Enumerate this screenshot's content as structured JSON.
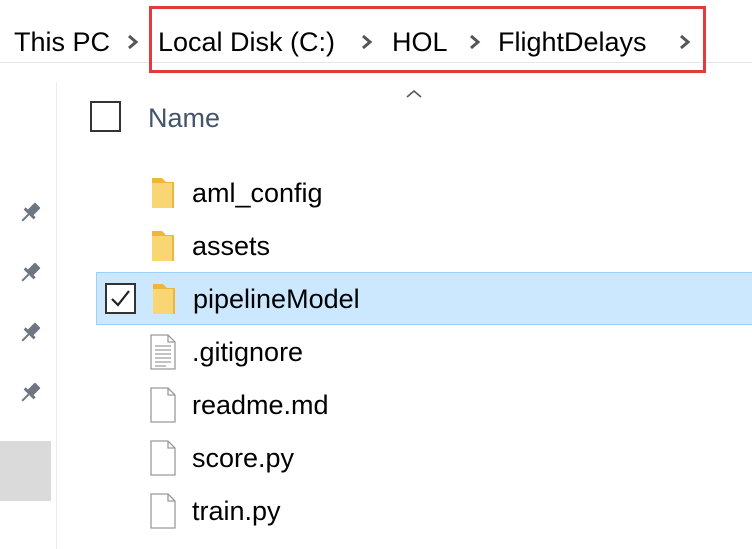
{
  "breadcrumb": {
    "items": [
      {
        "label": "This PC"
      },
      {
        "label": "Local Disk (C:)"
      },
      {
        "label": "HOL"
      },
      {
        "label": "FlightDelays"
      }
    ],
    "highlight_color": "#e03c3c"
  },
  "columns": {
    "name": "Name"
  },
  "files": [
    {
      "name": "aml_config",
      "type": "folder",
      "selected": false
    },
    {
      "name": "assets",
      "type": "folder",
      "selected": false
    },
    {
      "name": "pipelineModel",
      "type": "folder",
      "selected": true
    },
    {
      "name": ".gitignore",
      "type": "text-file",
      "selected": false
    },
    {
      "name": "readme.md",
      "type": "file",
      "selected": false
    },
    {
      "name": "score.py",
      "type": "file",
      "selected": false
    },
    {
      "name": "train.py",
      "type": "file",
      "selected": false
    }
  ],
  "colors": {
    "selection_bg": "#cce8ff",
    "selection_border": "#99d1ff",
    "folder": "#f7c84a",
    "header_text": "#44546a"
  }
}
